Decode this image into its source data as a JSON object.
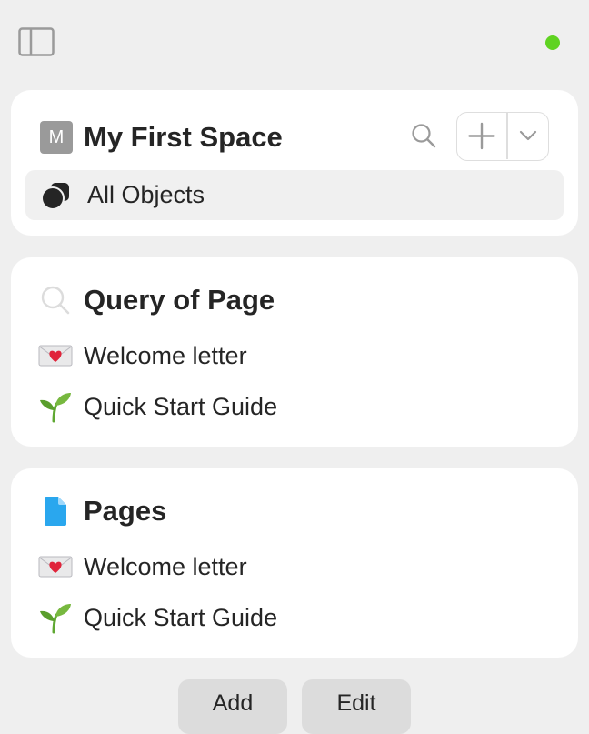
{
  "topbar": {
    "status_color": "#5fd321"
  },
  "space": {
    "avatar_letter": "M",
    "title": "My First Space",
    "all_objects_label": "All Objects"
  },
  "widgets": [
    {
      "icon": "search-icon",
      "title": "Query of Page",
      "items": [
        {
          "icon": "love-letter-emoji",
          "label": "Welcome letter"
        },
        {
          "icon": "seedling-emoji",
          "label": "Quick Start Guide"
        }
      ]
    },
    {
      "icon": "page-icon",
      "title": "Pages",
      "items": [
        {
          "icon": "love-letter-emoji",
          "label": "Welcome letter"
        },
        {
          "icon": "seedling-emoji",
          "label": "Quick Start Guide"
        }
      ]
    }
  ],
  "footer": {
    "add_label": "Add",
    "edit_label": "Edit"
  }
}
